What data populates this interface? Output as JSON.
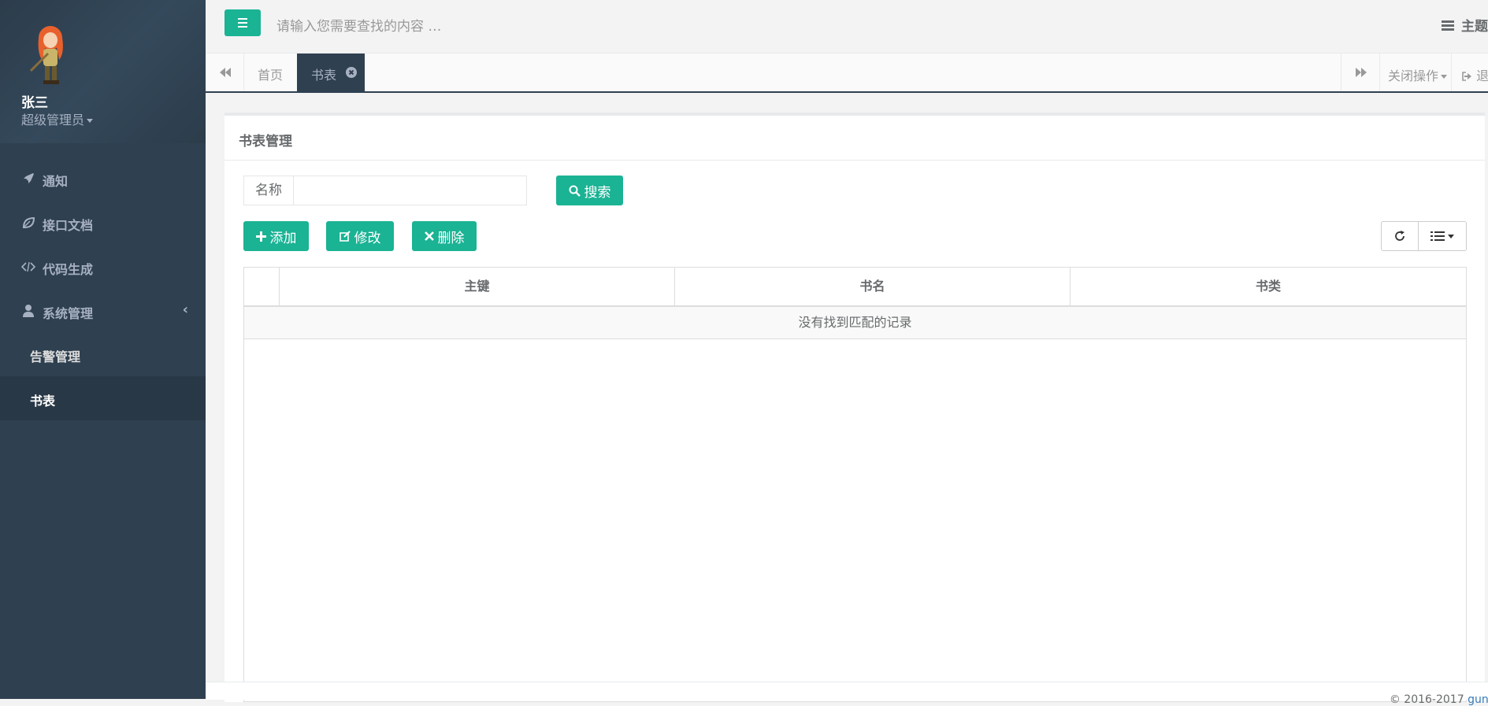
{
  "sidebar": {
    "user_name": "张三",
    "user_role": "超级管理员",
    "nav": [
      {
        "label": "通知",
        "icon": "rocket-icon"
      },
      {
        "label": "接口文档",
        "icon": "leaf-icon"
      },
      {
        "label": "代码生成",
        "icon": "code-icon"
      },
      {
        "label": "系统管理",
        "icon": "user-icon"
      }
    ],
    "sub_items": [
      {
        "label": "告警管理"
      },
      {
        "label": "书表"
      }
    ]
  },
  "topbar": {
    "search_placeholder": "请输入您需要查找的内容 …",
    "theme_label": "主题"
  },
  "tabs": {
    "home": "首页",
    "active": "书表",
    "close_ops": "关闭操作",
    "logout": "退"
  },
  "panel": {
    "title": "书表管理",
    "search_label": "名称",
    "search_value": "",
    "search_button": "搜索",
    "add_button": "添加",
    "edit_button": "修改",
    "delete_button": "删除"
  },
  "table": {
    "columns": [
      "主键",
      "书名",
      "书类"
    ],
    "empty_message": "没有找到匹配的记录"
  },
  "footer": {
    "copyright": "© 2016-2017 ",
    "link": "guns"
  },
  "colors": {
    "accent": "#1ab394",
    "sidebar": "#2f4050"
  }
}
